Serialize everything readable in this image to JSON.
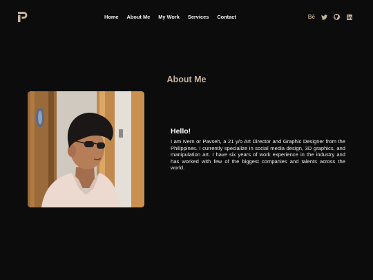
{
  "header": {
    "logo_icon": "p-logo-icon",
    "nav": [
      {
        "label": "Home"
      },
      {
        "label": "About Me"
      },
      {
        "label": "My Work"
      },
      {
        "label": "Services"
      },
      {
        "label": "Contact"
      }
    ],
    "social": {
      "behance_label": "Bē",
      "icons": [
        "behance-icon",
        "twitter-icon",
        "github-icon",
        "linkedin-icon"
      ]
    }
  },
  "about": {
    "title": "About Me",
    "greeting": "Hello!",
    "text": "I am Ivern or Pavseh, a 21 y/o Art Director and Graphic Designer from the Philippines. I currently specialize in social media design, 3D graphics, and manipulation art. I have six years of work experience in the industry and has worked with few of the biggest companies and talents across the world."
  },
  "colors": {
    "background": "#0d0c0c",
    "accent": "#c4b49c",
    "text": "#ececec"
  }
}
